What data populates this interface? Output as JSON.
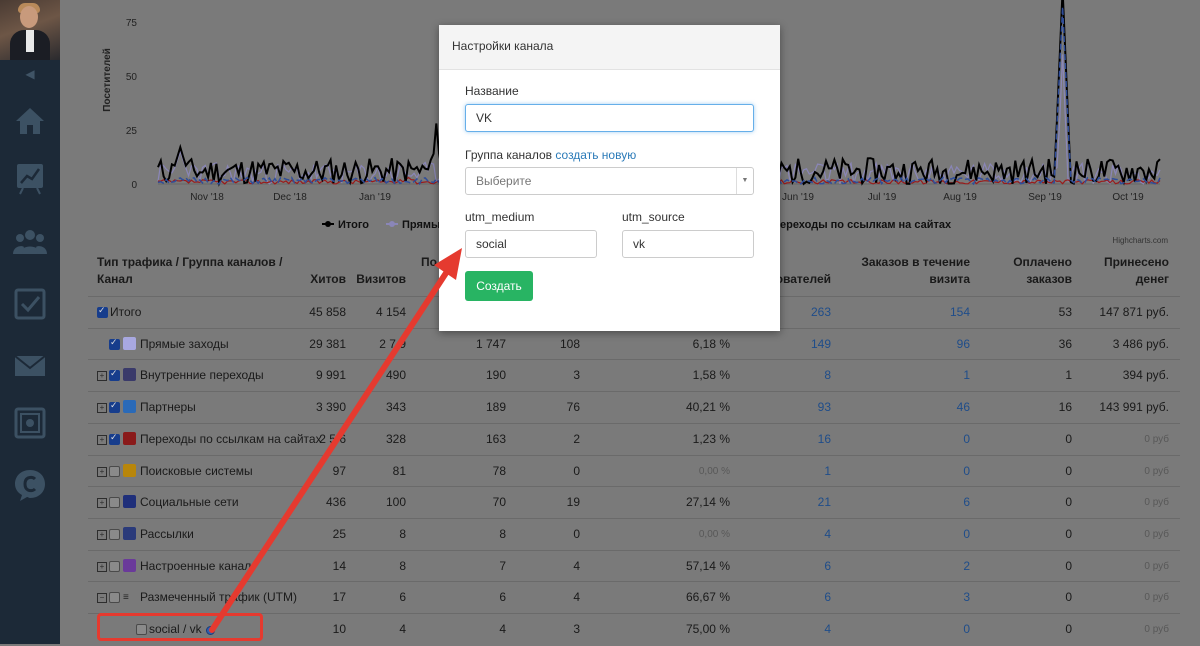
{
  "sidebar": {
    "icons": [
      "home-icon",
      "chart-icon",
      "users-icon",
      "checklist-icon",
      "mail-icon",
      "safe-icon",
      "chat-c-icon"
    ],
    "collapse_icon": "◀"
  },
  "chart": {
    "ylabel": "Посетителей",
    "yticks": [
      "0",
      "25",
      "50",
      "75"
    ],
    "xticks": [
      "Nov '18",
      "Dec '18",
      "Jan '19",
      "Jun '19",
      "Jul '19",
      "Aug '19",
      "Sep '19",
      "Oct '19"
    ],
    "legend": {
      "total": "Итого",
      "direct": "Прямы",
      "links": "ереходы по ссылкам на сайтах"
    },
    "credit": "Highcharts.com",
    "colors": {
      "total": "#000000",
      "direct": "#8a86b8",
      "red": "#9a1a1a",
      "blue": "#2f4d9a"
    }
  },
  "table": {
    "headers": {
      "type": "Тип трафика / Группа каналов / Канал",
      "hits": "Хитов",
      "visits": "Визитов",
      "col3": "По",
      "users": "ователей",
      "orders_visit": "Заказов в течение визита",
      "paid": "Оплачено заказов",
      "money": "Принесено денег"
    },
    "rows": [
      {
        "name": "Итого",
        "hits": "45 858",
        "visits": "4 154",
        "c3": "",
        "c4": "",
        "conv": "",
        "users": "263",
        "orders": "154",
        "paid": "53",
        "money": "147 871 руб."
      },
      {
        "name": "Прямые заходы",
        "hits": "29 381",
        "visits": "2 7 9",
        "c3": "1 747",
        "c4": "108",
        "conv": "6,18 %",
        "users": "149",
        "orders": "96",
        "paid": "36",
        "money": "3 486 руб."
      },
      {
        "name": "Внутренние переходы",
        "hits": "9 991",
        "visits": "490",
        "c3": "190",
        "c4": "3",
        "conv": "1,58 %",
        "users": "8",
        "orders": "1",
        "paid": "1",
        "money": "394 руб."
      },
      {
        "name": "Партнеры",
        "hits": "3 390",
        "visits": "343",
        "c3": "189",
        "c4": "76",
        "conv": "40,21 %",
        "users": "93",
        "orders": "46",
        "paid": "16",
        "money": "143 991 руб."
      },
      {
        "name": "Переходы по ссылкам на сайтах",
        "hits": "2 5 6",
        "visits": "328",
        "c3": "163",
        "c4": "2",
        "conv": "1,23 %",
        "users": "16",
        "orders": "0",
        "paid": "0",
        "money": "0 руб"
      },
      {
        "name": "Поисковые системы",
        "hits": "97",
        "visits": "81",
        "c3": "78",
        "c4": "0",
        "conv": "0,00 %",
        "users": "1",
        "orders": "0",
        "paid": "0",
        "money": "0 руб"
      },
      {
        "name": "Социальные сети",
        "hits": "436",
        "visits": "100",
        "c3": "70",
        "c4": "19",
        "conv": "27,14 %",
        "users": "21",
        "orders": "6",
        "paid": "0",
        "money": "0 руб"
      },
      {
        "name": "Рассылки",
        "hits": "25",
        "visits": "8",
        "c3": "8",
        "c4": "0",
        "conv": "0,00 %",
        "users": "4",
        "orders": "0",
        "paid": "0",
        "money": "0 руб"
      },
      {
        "name": "Настроенные канал",
        "hits": "14",
        "visits": "8",
        "c3": "7",
        "c4": "4",
        "conv": "57,14 %",
        "users": "6",
        "orders": "2",
        "paid": "0",
        "money": "0 руб"
      },
      {
        "name": "Размеченный трафик (UTM)",
        "hits": "17",
        "visits": "6",
        "c3": "6",
        "c4": "4",
        "conv": "66,67 %",
        "users": "6",
        "orders": "3",
        "paid": "0",
        "money": "0 руб"
      },
      {
        "name": "social / vk",
        "hits": "10",
        "visits": "4",
        "c3": "4",
        "c4": "3",
        "conv": "75,00 %",
        "users": "4",
        "orders": "0",
        "paid": "0",
        "money": "0 руб"
      }
    ]
  },
  "modal": {
    "title": "Настройки канала",
    "name_label": "Название",
    "name_value": "VK",
    "group_label": "Группа каналов",
    "group_link": "создать новую",
    "group_select": "Выберите",
    "medium_label": "utm_medium",
    "medium_value": "social",
    "source_label": "utm_source",
    "source_value": "vk",
    "create_button": "Создать"
  },
  "annotation": {
    "color": "#e53a2f"
  }
}
